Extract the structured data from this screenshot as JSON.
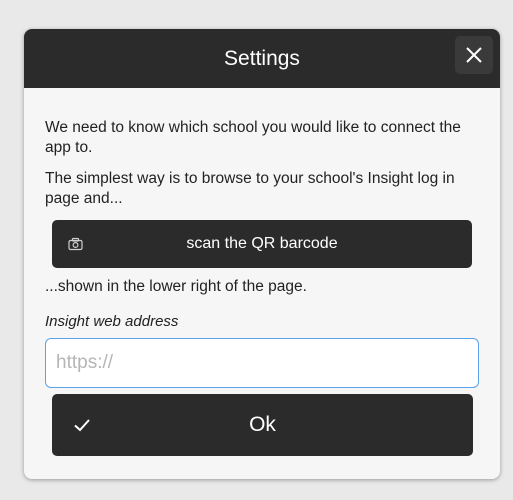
{
  "dialog": {
    "title": "Settings",
    "close_icon": "close-icon",
    "intro_text": "We need to know which school you would like to connect the app to.",
    "instruction_text": "The simplest way is to browse to your school's Insight log in page and...",
    "scan_button": {
      "label": "scan the QR barcode",
      "icon": "camera-icon"
    },
    "after_scan_text": "...shown in the lower right of the page.",
    "address_field": {
      "label": "Insight web address",
      "value": "",
      "placeholder": "https://"
    },
    "ok_button": {
      "label": "Ok",
      "icon": "checkmark-icon"
    }
  },
  "colors": {
    "header_bg": "#2b2b2b",
    "button_bg": "#2b2b2b",
    "dialog_bg": "#f6f6f6",
    "page_bg": "#e9e9e9",
    "input_focus_border": "#5aa3e8"
  }
}
